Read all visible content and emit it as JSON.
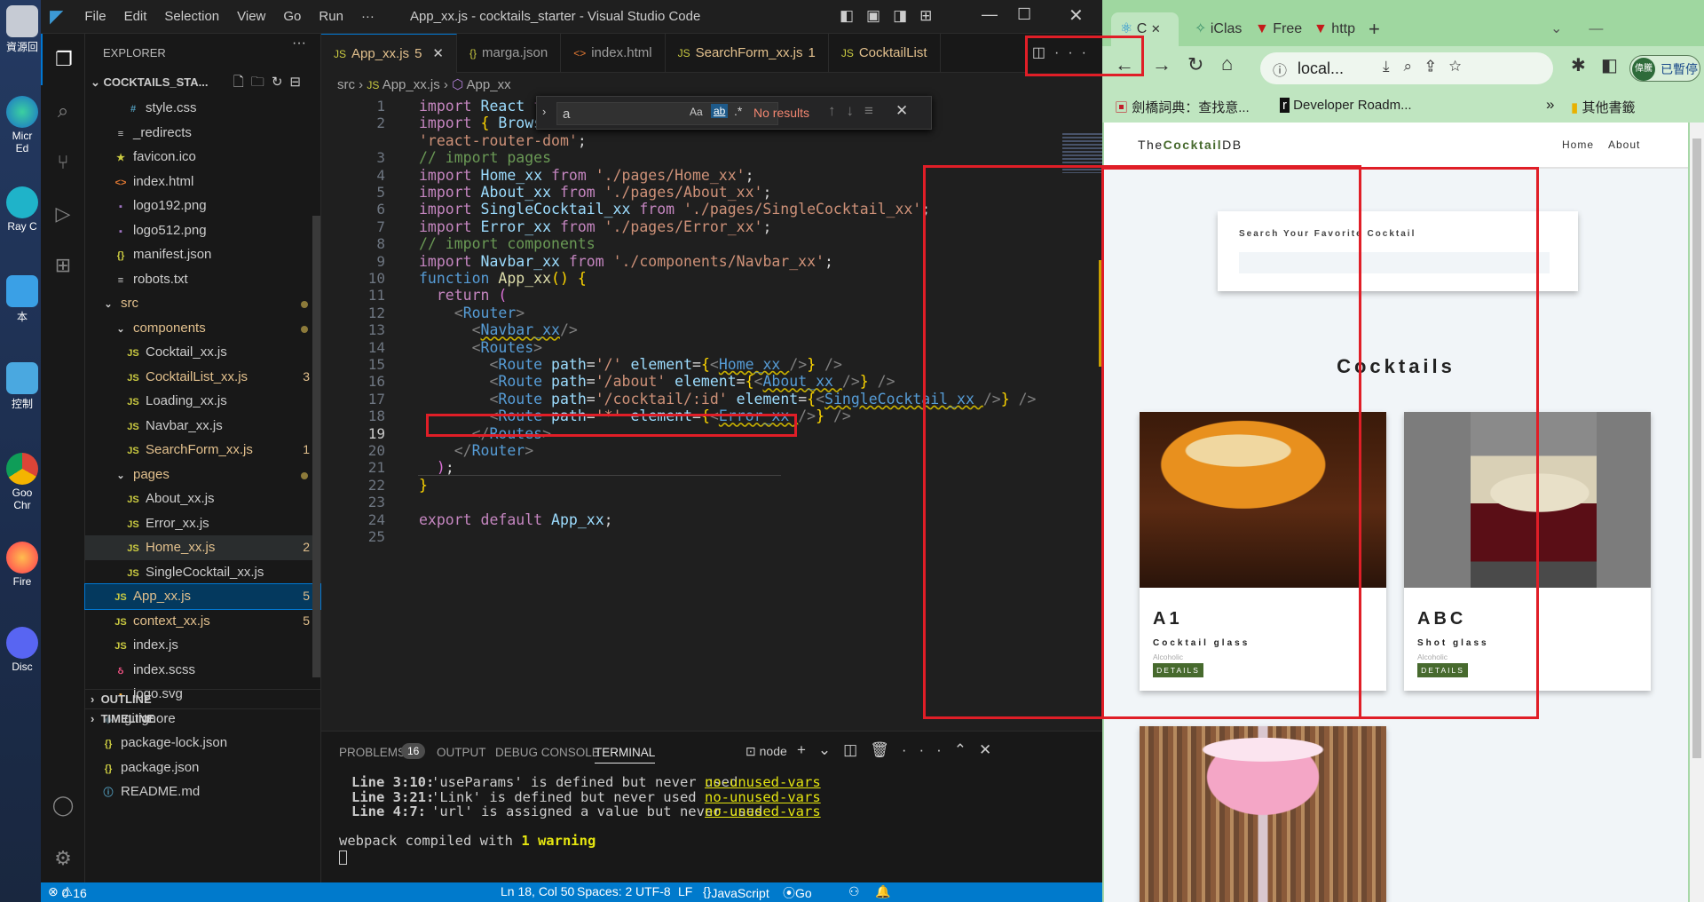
{
  "desktop": {
    "icons": [
      "資源回",
      "Micr\nEd",
      "Ray C",
      "本",
      "控制",
      "Goo\nChr",
      "Fire",
      "Disc"
    ]
  },
  "vscode": {
    "menu": [
      "File",
      "Edit",
      "Selection",
      "View",
      "Go",
      "Run",
      "···"
    ],
    "title": "App_xx.js - cocktails_starter - Visual Studio Code",
    "explorer_title": "EXPLORER",
    "project": "COCKTAILS_STA...",
    "files": [
      {
        "label": "style.css",
        "icon": "#",
        "color": "#519aba",
        "indent": 2
      },
      {
        "label": "_redirects",
        "icon": "≡",
        "color": "#ccc",
        "indent": 1
      },
      {
        "label": "favicon.ico",
        "icon": "★",
        "color": "#cbcb41",
        "indent": 1
      },
      {
        "label": "index.html",
        "icon": "<>",
        "color": "#e37933",
        "indent": 1
      },
      {
        "label": "logo192.png",
        "icon": "▪",
        "color": "#a074c4",
        "indent": 1
      },
      {
        "label": "logo512.png",
        "icon": "▪",
        "color": "#a074c4",
        "indent": 1
      },
      {
        "label": "manifest.json",
        "icon": "{}",
        "color": "#cbcb41",
        "indent": 1
      },
      {
        "label": "robots.txt",
        "icon": "≡",
        "color": "#ccc",
        "indent": 1
      },
      {
        "label": "src",
        "icon": "⌄",
        "color": "#ccc",
        "indent": 0,
        "text": "#e2c08d",
        "dot": true
      },
      {
        "label": "components",
        "icon": "⌄",
        "color": "#ccc",
        "indent": 1,
        "text": "#e2c08d",
        "dot": true
      },
      {
        "label": "Cocktail_xx.js",
        "icon": "JS",
        "color": "#cbcb41",
        "indent": 2
      },
      {
        "label": "CocktailList_xx.js",
        "icon": "JS",
        "color": "#cbcb41",
        "indent": 2,
        "text": "#e2c08d",
        "badge": "3"
      },
      {
        "label": "Loading_xx.js",
        "icon": "JS",
        "color": "#cbcb41",
        "indent": 2
      },
      {
        "label": "Navbar_xx.js",
        "icon": "JS",
        "color": "#cbcb41",
        "indent": 2
      },
      {
        "label": "SearchForm_xx.js",
        "icon": "JS",
        "color": "#cbcb41",
        "indent": 2,
        "text": "#e2c08d",
        "badge": "1"
      },
      {
        "label": "pages",
        "icon": "⌄",
        "color": "#ccc",
        "indent": 1,
        "text": "#e2c08d",
        "dot": true
      },
      {
        "label": "About_xx.js",
        "icon": "JS",
        "color": "#cbcb41",
        "indent": 2
      },
      {
        "label": "Error_xx.js",
        "icon": "JS",
        "color": "#cbcb41",
        "indent": 2
      },
      {
        "label": "Home_xx.js",
        "icon": "JS",
        "color": "#cbcb41",
        "indent": 2,
        "text": "#e2c08d",
        "badge": "2",
        "hl": true
      },
      {
        "label": "SingleCocktail_xx.js",
        "icon": "JS",
        "color": "#cbcb41",
        "indent": 2
      },
      {
        "label": "App_xx.js",
        "icon": "JS",
        "color": "#cbcb41",
        "indent": 1,
        "text": "#e2c08d",
        "badge": "5",
        "sel": true
      },
      {
        "label": "context_xx.js",
        "icon": "JS",
        "color": "#cbcb41",
        "indent": 1,
        "text": "#e2c08d",
        "badge": "5"
      },
      {
        "label": "index.js",
        "icon": "JS",
        "color": "#cbcb41",
        "indent": 1
      },
      {
        "label": "index.scss",
        "icon": "ઠ",
        "color": "#f55385",
        "indent": 1
      },
      {
        "label": "logo.svg",
        "icon": "▪",
        "color": "#ffb13b",
        "indent": 1
      },
      {
        "label": ".gitignore",
        "icon": "◆",
        "color": "#41535b",
        "indent": 0
      },
      {
        "label": "package-lock.json",
        "icon": "{}",
        "color": "#cbcb41",
        "indent": 0
      },
      {
        "label": "package.json",
        "icon": "{}",
        "color": "#cbcb41",
        "indent": 0
      },
      {
        "label": "README.md",
        "icon": "ⓘ",
        "color": "#519aba",
        "indent": 0
      }
    ],
    "outline": "OUTLINE",
    "timeline": "TIMELINE",
    "tabs": [
      {
        "label": "App_xx.js",
        "badge": "5",
        "icon": "JS",
        "active": true
      },
      {
        "label": "marga.json",
        "icon": "{}"
      },
      {
        "label": "index.html",
        "icon": "<>"
      },
      {
        "label": "SearchForm_xx.js",
        "badge": "1",
        "icon": "JS"
      },
      {
        "label": "CocktailList",
        "icon": "JS"
      }
    ],
    "breadcrumb": [
      "src",
      "App_xx.js",
      "App_xx"
    ],
    "find": {
      "value": "a",
      "result": "No results",
      "aa": "Aa",
      "ab": "ab",
      "re": ".*"
    },
    "lines": [
      [
        [
          "kw",
          "import "
        ],
        [
          "vr",
          "React "
        ],
        [
          "kw",
          "fr"
        ]
      ],
      [
        [
          "kw",
          "import "
        ],
        [
          "br",
          "{ "
        ],
        [
          "vr",
          "Browser"
        ]
      ],
      [
        [
          "st",
          "'react-router-dom'"
        ],
        [
          "",
          "; "
        ]
      ],
      [
        [
          "cm",
          "// import pages"
        ]
      ],
      [
        [
          "kw",
          "import "
        ],
        [
          "vr",
          "Home_xx "
        ],
        [
          "kw",
          "from "
        ],
        [
          "st",
          "'./pages/Home_xx'"
        ],
        [
          "",
          ";"
        ]
      ],
      [
        [
          "kw",
          "import "
        ],
        [
          "vr",
          "About_xx "
        ],
        [
          "kw",
          "from "
        ],
        [
          "st",
          "'./pages/About_xx'"
        ],
        [
          "",
          ";"
        ]
      ],
      [
        [
          "kw",
          "import "
        ],
        [
          "vr",
          "SingleCocktail_xx "
        ],
        [
          "kw",
          "from "
        ],
        [
          "st",
          "'./pages/SingleCocktail_xx'"
        ],
        [
          "",
          ";"
        ]
      ],
      [
        [
          "kw",
          "import "
        ],
        [
          "vr",
          "Error_xx "
        ],
        [
          "kw",
          "from "
        ],
        [
          "st",
          "'./pages/Error_xx'"
        ],
        [
          "",
          ";"
        ]
      ],
      [
        [
          "cm",
          "// import components"
        ]
      ],
      [
        [
          "kw",
          "import "
        ],
        [
          "vr",
          "Navbar_xx "
        ],
        [
          "kw",
          "from "
        ],
        [
          "st",
          "'./components/Navbar_xx'"
        ],
        [
          "",
          ";"
        ]
      ],
      [
        [
          "tg",
          "function "
        ],
        [
          "fn",
          "App_xx"
        ],
        [
          "br",
          "() {"
        ]
      ],
      [
        [
          "",
          "  "
        ],
        [
          "kw",
          "return "
        ],
        [
          "br2",
          "("
        ]
      ],
      [
        [
          "",
          "    "
        ],
        [
          "gr",
          "<"
        ],
        [
          "tg",
          "Router"
        ],
        [
          "gr",
          ">"
        ]
      ],
      [
        [
          "",
          "      "
        ],
        [
          "gr",
          "<"
        ],
        [
          "tg sq",
          "Navbar_xx"
        ],
        [
          "gr",
          "/>"
        ]
      ],
      [
        [
          "",
          "      "
        ],
        [
          "gr",
          "<"
        ],
        [
          "tg",
          "Routes"
        ],
        [
          "gr",
          ">"
        ]
      ],
      [
        [
          "",
          "        "
        ],
        [
          "gr",
          "<"
        ],
        [
          "tg",
          "Route "
        ],
        [
          "vr",
          "path"
        ],
        [
          "",
          "="
        ],
        [
          "st",
          "'/' "
        ],
        [
          "vr",
          "element"
        ],
        [
          "",
          "="
        ],
        [
          "br",
          "{"
        ],
        [
          "gr",
          "<"
        ],
        [
          "tg sq",
          "Home_xx "
        ],
        [
          "gr",
          "/>"
        ],
        [
          "br",
          "}"
        ],
        [
          "gr",
          " />"
        ]
      ],
      [
        [
          "",
          "        "
        ],
        [
          "gr",
          "<"
        ],
        [
          "tg",
          "Route "
        ],
        [
          "vr",
          "path"
        ],
        [
          "",
          "="
        ],
        [
          "st",
          "'/about' "
        ],
        [
          "vr",
          "element"
        ],
        [
          "",
          "="
        ],
        [
          "br",
          "{"
        ],
        [
          "gr",
          "<"
        ],
        [
          "tg sq",
          "About_xx "
        ],
        [
          "gr",
          "/>"
        ],
        [
          "br",
          "}"
        ],
        [
          "gr",
          " />"
        ]
      ],
      [
        [
          "",
          "        "
        ],
        [
          "gr",
          "<"
        ],
        [
          "tg",
          "Route "
        ],
        [
          "vr",
          "path"
        ],
        [
          "",
          "="
        ],
        [
          "st",
          "'/cocktail/:id' "
        ],
        [
          "vr",
          "element"
        ],
        [
          "",
          "="
        ],
        [
          "br",
          "{"
        ],
        [
          "gr",
          "<"
        ],
        [
          "tg sq",
          "SingleCocktail_xx "
        ],
        [
          "gr",
          "/>"
        ],
        [
          "br",
          "}"
        ],
        [
          "gr",
          " />"
        ]
      ],
      [
        [
          "",
          "        "
        ],
        [
          "gr",
          "<"
        ],
        [
          "tg",
          "Route "
        ],
        [
          "vr",
          "path"
        ],
        [
          "",
          "="
        ],
        [
          "st",
          "'*' "
        ],
        [
          "vr",
          "element"
        ],
        [
          "",
          "="
        ],
        [
          "br",
          "{"
        ],
        [
          "gr",
          "<"
        ],
        [
          "tg sq",
          "Error_xx "
        ],
        [
          "gr",
          "/>"
        ],
        [
          "br",
          "}"
        ],
        [
          "gr",
          " />"
        ]
      ],
      [
        [
          "",
          "      "
        ],
        [
          "gr",
          "</"
        ],
        [
          "tg",
          "Routes"
        ],
        [
          "gr",
          ">"
        ]
      ],
      [
        [
          "",
          "    "
        ],
        [
          "gr",
          "</"
        ],
        [
          "tg",
          "Router"
        ],
        [
          "gr",
          ">"
        ]
      ],
      [
        [
          "",
          "  "
        ],
        [
          "br2",
          ")"
        ],
        [
          "",
          ";"
        ]
      ],
      [
        [
          "br",
          "}"
        ]
      ],
      [
        [
          "",
          ""
        ]
      ],
      [
        [
          "kw",
          "export "
        ],
        [
          "kw",
          "default "
        ],
        [
          "vr",
          "App_xx"
        ],
        [
          "",
          ";"
        ]
      ],
      [
        [
          "",
          ""
        ]
      ]
    ],
    "line_numbers": [
      "1",
      "2",
      "",
      "3",
      "4",
      "5",
      "6",
      "7",
      "8",
      "9",
      "10",
      "11",
      "12",
      "13",
      "14",
      "15",
      "16",
      "17",
      "18",
      "19",
      "20",
      "21",
      "22",
      "23",
      "24",
      "25"
    ],
    "panel": {
      "tabs": [
        "PROBLEMS",
        "OUTPUT",
        "DEBUG CONSOLE",
        "TERMINAL"
      ],
      "problems_count": "16",
      "terminal_select": "node",
      "lines": [
        {
          "pos": "Line 3:10:",
          "msg": "'useParams' is defined but never used",
          "rule": "no-unused-vars"
        },
        {
          "pos": "Line 3:21:",
          "msg": "'Link' is defined but never used",
          "rule": "no-unused-vars"
        },
        {
          "pos": "Line 4:7:",
          "msg": "'url' is assigned a value but never used",
          "rule": "no-unused-vars"
        }
      ],
      "compiled_pre": "webpack compiled with ",
      "compiled_count": "1 warning"
    },
    "status": {
      "errors": "0",
      "warnings": "16",
      "position": "Ln 18, Col 50",
      "spaces": "Spaces: 2",
      "encoding": "UTF-8",
      "eol": "LF",
      "lang": "JavaScript",
      "golive": "Go Live"
    }
  },
  "chrome": {
    "tabs": [
      "C",
      "iClas",
      "Free",
      "http"
    ],
    "url": "local...",
    "profile": "已暫停",
    "avatar": "偉騰",
    "bookmarks": [
      "劍橋詞典：查找意...",
      "Developer Roadm..."
    ],
    "bookmarks_other": "其他書籤",
    "accent": "#476a2e",
    "site": {
      "logo_pre": "The",
      "logo_bold": "Cocktail",
      "logo_post": "DB",
      "nav": [
        "Home",
        "About"
      ],
      "search_label": "Search Your Favorite Cocktail",
      "heading": "Cocktails",
      "cards": [
        {
          "name": "A1",
          "glass": "Cocktail glass",
          "alcoholic": "Alcoholic",
          "button": "DETAILS"
        },
        {
          "name": "ABC",
          "glass": "Shot glass",
          "alcoholic": "Alcoholic",
          "button": "DETAILS"
        }
      ]
    }
  }
}
